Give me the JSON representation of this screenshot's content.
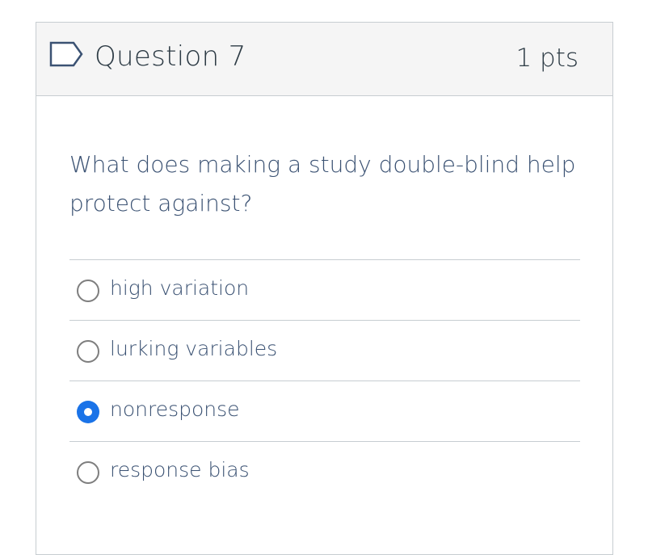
{
  "question": {
    "title": "Question 7",
    "points": "1 pts",
    "text": "What does making a study double-blind help protect against?"
  },
  "answers": [
    {
      "label": "high variation",
      "selected": false
    },
    {
      "label": "lurking variables",
      "selected": false
    },
    {
      "label": "nonresponse",
      "selected": true
    },
    {
      "label": "response bias",
      "selected": false
    }
  ],
  "colors": {
    "title": "#2d3b45",
    "text": "#3b5273",
    "selected_radio": "#1a73e8",
    "border": "#c7cdd1",
    "header_bg": "#f5f5f5"
  },
  "icons": {
    "flag": "flag-question-icon"
  }
}
